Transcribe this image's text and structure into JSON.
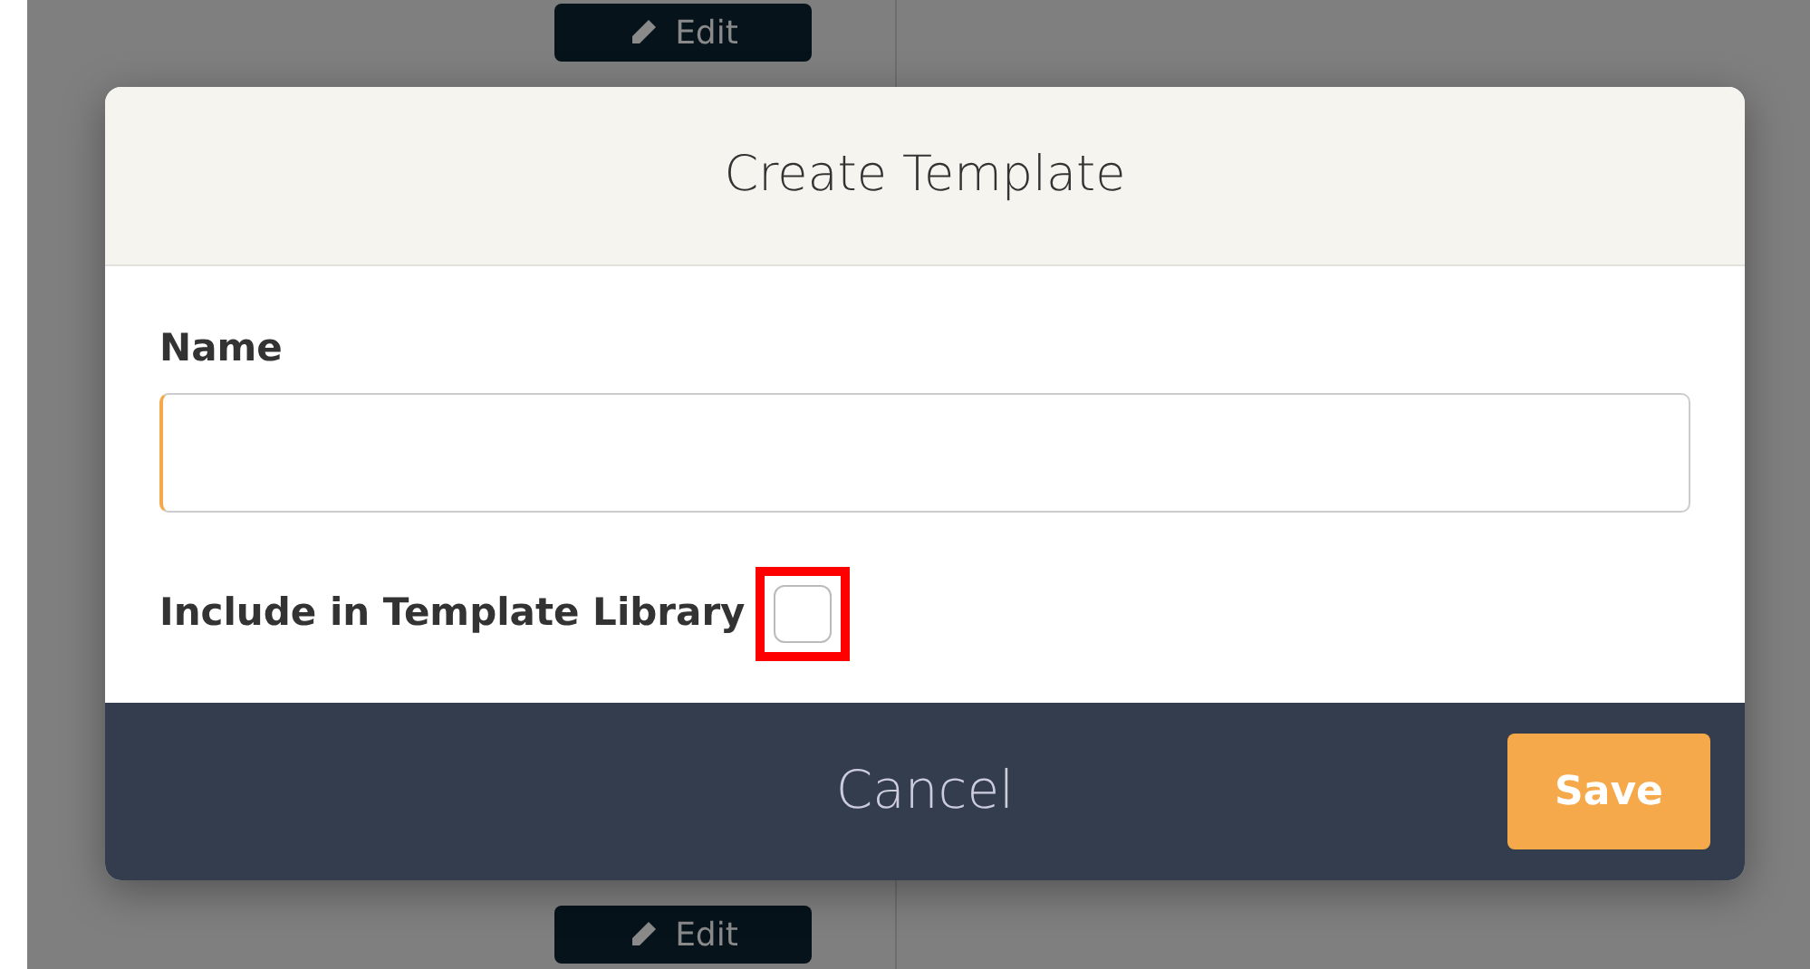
{
  "background": {
    "edit_buttons": [
      {
        "label": "Edit"
      },
      {
        "label": "Edit"
      }
    ]
  },
  "dialog": {
    "title": "Create Template",
    "name_field": {
      "label": "Name",
      "focused": true
    },
    "library_checkbox": {
      "label": "Include in Template Library",
      "checked": false,
      "highlighted": true
    },
    "buttons": [
      {
        "kind": "cancel",
        "label": "Cancel"
      },
      {
        "kind": "save",
        "label": "Save"
      }
    ]
  }
}
